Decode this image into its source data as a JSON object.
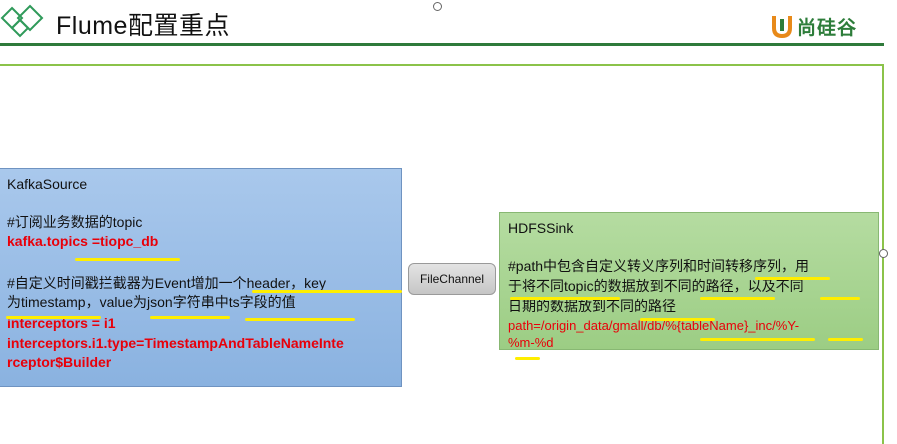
{
  "slide": {
    "title": "Flume配置重点",
    "brand_name": "尚硅谷",
    "accent_color": "#2f7a3b",
    "frame_color": "#8bc34a"
  },
  "nodes": {
    "kafka_source": {
      "title": "KafkaSource",
      "comment_topic": "#订阅业务数据的topic",
      "config_topics": "kafka.topics =tiopc_db",
      "comment_interceptor_1": "#自定义时间戳拦截器为Event增加一个header，key",
      "comment_interceptor_2": "为timestamp，value为json字符串中ts字段的值",
      "config_interceptors": "interceptors = i1",
      "config_interceptor_type_1": "interceptors.i1.type=TimestampAndTableNameInte",
      "config_interceptor_type_2": "rceptor$Builder",
      "fill_color": "#9dbde6"
    },
    "file_channel": {
      "label": "FileChannel"
    },
    "hdfs_sink": {
      "title": "HDFSSink",
      "comment_1": "#path中包含自定义转义序列和时间转移序列，用",
      "comment_2": "于将不同topic的数据放到不同的路径，以及不同",
      "comment_3": "日期的数据放到不同的路径",
      "config_path_1": "path=/origin_data/gmall/db/%{tableName}_inc/%Y-",
      "config_path_2": "%m-%d",
      "fill_color": "#a9d592"
    }
  },
  "highlight_color": "#ffee00",
  "icons": [
    "diamond-logo-icon",
    "brand-u-icon"
  ]
}
